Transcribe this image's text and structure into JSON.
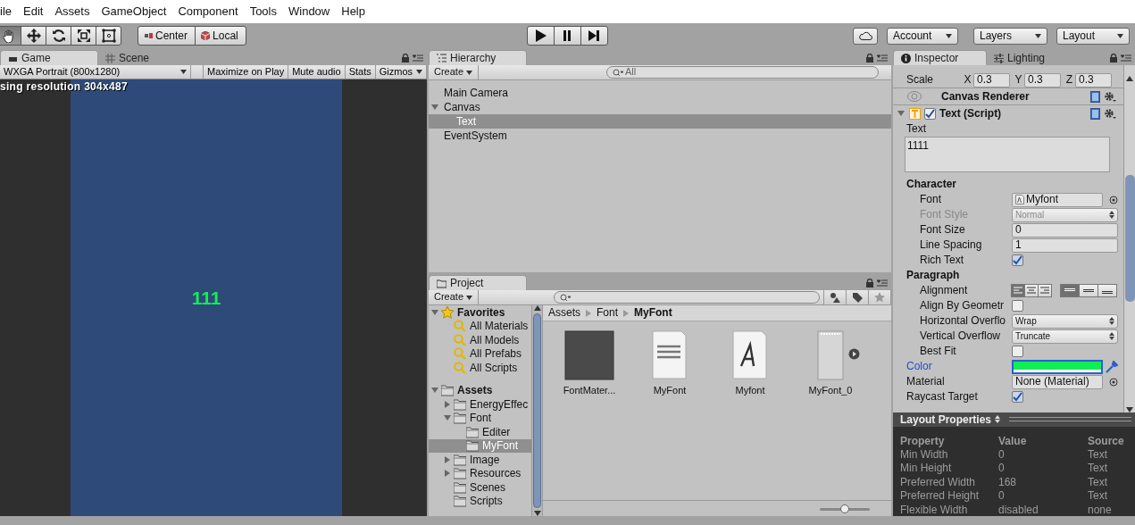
{
  "menu": [
    "ile",
    "Edit",
    "Assets",
    "GameObject",
    "Component",
    "Tools",
    "Window",
    "Help"
  ],
  "toolbar": {
    "tools": [
      {
        "kind": "hand",
        "selected": true
      },
      {
        "kind": "move",
        "selected": false
      },
      {
        "kind": "rotate",
        "selected": false
      },
      {
        "kind": "scale",
        "selected": false
      },
      {
        "kind": "rect",
        "selected": false
      }
    ],
    "pivot": [
      {
        "kind": "center",
        "label": "Center"
      },
      {
        "kind": "local",
        "label": "Local"
      }
    ],
    "play": [
      {
        "kind": "play",
        "on": false
      },
      {
        "kind": "pause",
        "on": false
      },
      {
        "kind": "step",
        "on": false
      }
    ],
    "menus": [
      "Account",
      "Layers",
      "Layout"
    ]
  },
  "game": {
    "tabs": [
      {
        "label": "Game",
        "kind": "game",
        "selected": true
      },
      {
        "label": "Scene",
        "kind": "scene",
        "selected": false
      }
    ],
    "resolution": "WXGA Portrait (800x1280)",
    "buttons": [
      "Maximize on Play",
      "Mute audio",
      "Stats",
      "Gizmos"
    ],
    "notice": "sing resolution 304x487",
    "text": "111"
  },
  "hierarchy": {
    "title": "Hierarchy",
    "create": "Create",
    "placeholder": "All",
    "items": [
      {
        "label": "Main Camera",
        "selected": false
      },
      {
        "label": "Canvas",
        "selected": false,
        "expanded": true,
        "children": [
          {
            "label": "Text",
            "selected": true
          }
        ]
      },
      {
        "label": "EventSystem",
        "selected": false
      }
    ]
  },
  "project": {
    "title": "Project",
    "create": "Create",
    "tree": [
      {
        "label": "Favorites",
        "kind": "favorites",
        "expanded": true,
        "selected": false,
        "children": [
          {
            "label": "All Materials",
            "kind": "search",
            "selected": false
          },
          {
            "label": "All Models",
            "kind": "search",
            "selected": false
          },
          {
            "label": "All Prefabs",
            "kind": "search",
            "selected": false
          },
          {
            "label": "All Scripts",
            "kind": "search",
            "selected": false
          }
        ]
      },
      {
        "label": "Assets",
        "kind": "root",
        "expanded": true,
        "selected": false,
        "children": [
          {
            "label": "EnergyEffec",
            "kind": "folder",
            "expanded": false,
            "selected": false
          },
          {
            "label": "Font",
            "kind": "folder",
            "expanded": true,
            "selected": false,
            "children": [
              {
                "label": "Editer",
                "kind": "folder",
                "selected": false
              },
              {
                "label": "MyFont",
                "kind": "folder",
                "selected": true
              }
            ]
          },
          {
            "label": "Image",
            "kind": "folder",
            "expanded": false,
            "selected": false
          },
          {
            "label": "Resources",
            "kind": "folder",
            "expanded": false,
            "selected": false
          },
          {
            "label": "Scenes",
            "kind": "folder",
            "selected": false
          },
          {
            "label": "Scripts",
            "kind": "folder",
            "selected": false
          }
        ]
      }
    ],
    "breadcrumb": [
      "Assets",
      "Font",
      "MyFont"
    ],
    "assets": [
      {
        "label": "FontMater...",
        "kind": "material"
      },
      {
        "label": "MyFont",
        "kind": "fontsample"
      },
      {
        "label": "Myfont",
        "kind": "font"
      },
      {
        "label": "MyFont_0",
        "kind": "texture"
      }
    ],
    "zoom": {
      "level": 0.5
    }
  },
  "inspector": {
    "tabs": [
      {
        "label": "Inspector",
        "kind": "info",
        "selected": true
      },
      {
        "label": "Lighting",
        "kind": "lighting",
        "selected": false
      }
    ],
    "scale": {
      "label": "Scale",
      "axes": [
        {
          "axis": "X",
          "value": "0.3"
        },
        {
          "axis": "Y",
          "value": "0.3"
        },
        {
          "axis": "Z",
          "value": "0.3"
        }
      ]
    },
    "components": [
      {
        "name": "Canvas Renderer",
        "kind": "renderer"
      },
      {
        "name": "Text (Script)",
        "kind": "script",
        "enabled": true,
        "expanded": true
      }
    ],
    "text_label": "Text",
    "text_value": "1111",
    "fields": [
      {
        "kind": "header",
        "label": "Character",
        "children": [
          {
            "kind": "object",
            "label": "Font",
            "value": "Myfont",
            "icon": true
          },
          {
            "kind": "dropdown",
            "label": "Font Style",
            "value": "Normal",
            "disabled": true
          },
          {
            "kind": "input",
            "label": "Font Size",
            "value": "0"
          },
          {
            "kind": "input",
            "label": "Line Spacing",
            "value": "1"
          },
          {
            "kind": "checkbox",
            "label": "Rich Text",
            "checked": true
          }
        ]
      },
      {
        "kind": "header",
        "label": "Paragraph",
        "children": [
          {
            "kind": "align",
            "label": "Alignment",
            "horizontal": [
              {
                "kind": "left",
                "selected": true
              },
              {
                "kind": "center",
                "selected": false
              },
              {
                "kind": "right",
                "selected": false
              }
            ],
            "vertical": [
              {
                "kind": "top",
                "selected": true
              },
              {
                "kind": "middle",
                "selected": false
              },
              {
                "kind": "bottom",
                "selected": false
              }
            ]
          },
          {
            "kind": "checkbox",
            "label": "Align By Geometr",
            "checked": false
          },
          {
            "kind": "dropdown",
            "label": "Horizontal Overflo",
            "value": "Wrap",
            "disabled": false
          },
          {
            "kind": "dropdown",
            "label": "Vertical Overflow",
            "value": "Truncate",
            "disabled": false
          },
          {
            "kind": "checkbox",
            "label": "Best Fit",
            "checked": false
          }
        ]
      },
      {
        "kind": "color",
        "label": "Color",
        "color": "#11ee55",
        "focused": true
      },
      {
        "kind": "object",
        "label": "Material",
        "value": "None (Material)",
        "icon": false
      },
      {
        "kind": "checkbox",
        "label": "Raycast Target",
        "checked": true
      }
    ]
  },
  "layout_properties": {
    "title": "Layout Properties",
    "columns": [
      "Property",
      "Value",
      "Source"
    ],
    "rows": [
      [
        "Min Width",
        "0",
        "Text"
      ],
      [
        "Min Height",
        "0",
        "Text"
      ],
      [
        "Preferred Width",
        "168",
        "Text"
      ],
      [
        "Preferred Height",
        "0",
        "Text"
      ],
      [
        "Flexible Width",
        "disabled",
        "none"
      ]
    ]
  }
}
